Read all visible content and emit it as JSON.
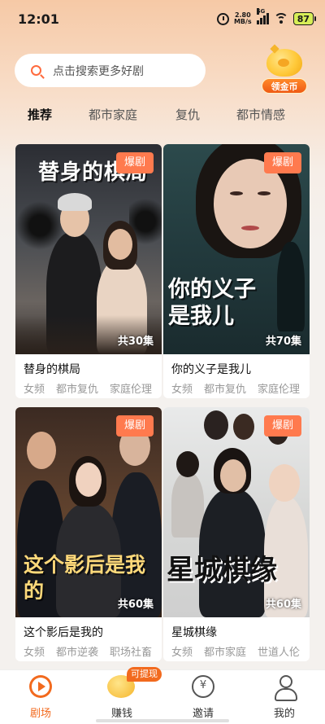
{
  "status_bar": {
    "time": "12:01",
    "net_speed_value": "2.80",
    "net_speed_unit": "MB/s",
    "signal_type": "5G",
    "battery": "87"
  },
  "search": {
    "placeholder": "点击搜索更多好剧"
  },
  "coin_widget": {
    "label": "领金币"
  },
  "tabs": [
    {
      "label": "推荐",
      "active": true
    },
    {
      "label": "都市家庭"
    },
    {
      "label": "复仇"
    },
    {
      "label": "都市情感"
    }
  ],
  "cards": [
    {
      "badge": "爆剧",
      "poster_title": "替身的棋局",
      "episodes": "共30集",
      "title": "替身的棋局",
      "tags": [
        "女频",
        "都市复仇",
        "家庭伦理"
      ]
    },
    {
      "badge": "爆剧",
      "poster_title": "你的义子是我儿",
      "episodes": "共70集",
      "title": "你的义子是我儿",
      "tags": [
        "女频",
        "都市复仇",
        "家庭伦理"
      ]
    },
    {
      "badge": "爆剧",
      "poster_title": "这个影后是我的",
      "episodes": "共60集",
      "title": "这个影后是我的",
      "tags": [
        "女频",
        "都市逆袭",
        "职场社畜"
      ]
    },
    {
      "badge": "爆剧",
      "poster_title": "星城棋缘",
      "episodes": "共60集",
      "title": "星城棋缘",
      "tags": [
        "女频",
        "都市家庭",
        "世道人伦"
      ]
    }
  ],
  "bottom_nav": [
    {
      "label": "剧场",
      "icon": "theater-icon",
      "active": true
    },
    {
      "label": "赚钱",
      "icon": "piggy-bank-icon",
      "tag": "可提现"
    },
    {
      "label": "邀请",
      "icon": "gift-coin-icon"
    },
    {
      "label": "我的",
      "icon": "user-icon"
    }
  ],
  "colors": {
    "accent": "#f26a1e",
    "badge": "#ff7a4e"
  }
}
